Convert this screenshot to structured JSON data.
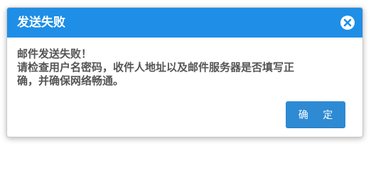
{
  "dialog": {
    "title": "发送失败",
    "close_icon": "close-circle-icon",
    "message_lines": [
      "邮件发送失败！",
      "请检查用户名密码，收件人地址以及邮件服务器是否填写正",
      "确，并确保网络畅通。"
    ],
    "ok_label": "确 定"
  },
  "colors": {
    "titlebar": "#1f8ee6",
    "button": "#2e8ad3",
    "text": "#555555",
    "title_text": "#ffffff"
  }
}
